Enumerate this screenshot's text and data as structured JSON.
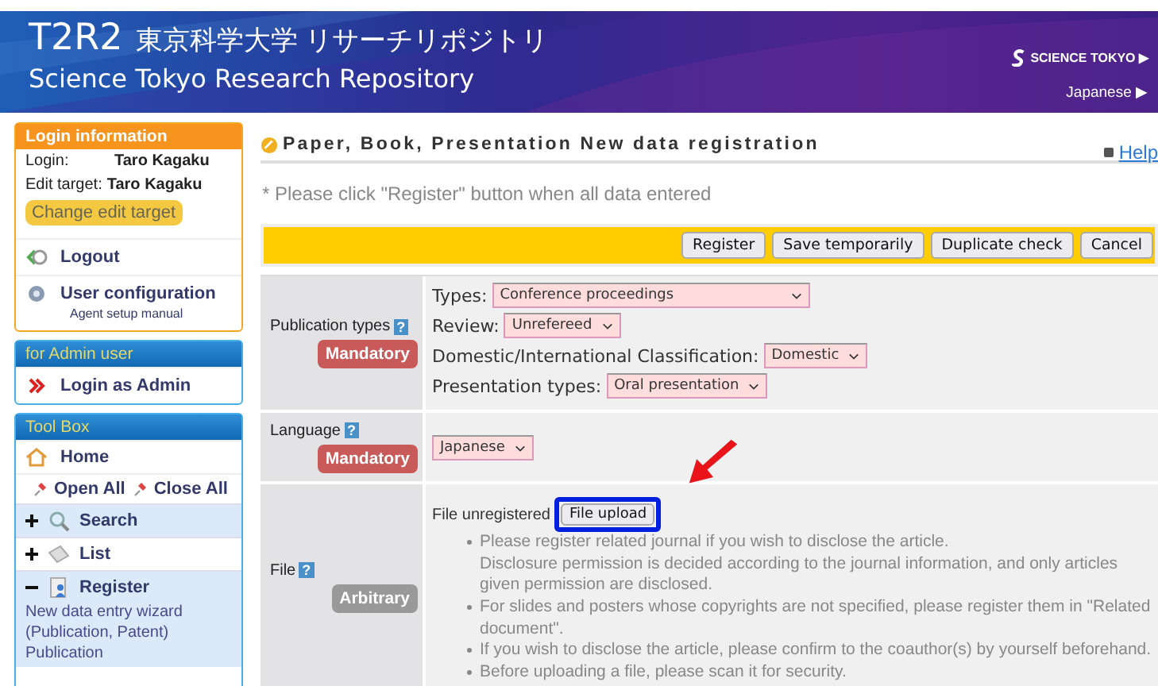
{
  "header": {
    "logo": "T2R2",
    "title_ja": "東京科学大学 リサーチリポジトリ",
    "title_en": "Science Tokyo Research Repository",
    "institute": "SCIENCE TOKYO ▶",
    "language_link": "Japanese ▶"
  },
  "login_box": {
    "title": "Login information",
    "rows": [
      {
        "label": "Login:",
        "value": "Taro Kagaku"
      },
      {
        "label": "Edit target:",
        "value": "Taro Kagaku"
      }
    ],
    "change_button": "Change edit target",
    "links": [
      {
        "kind": "logout",
        "label": "Logout"
      },
      {
        "kind": "gear",
        "label": "User configuration",
        "sub_link": "Agent setup manual"
      }
    ]
  },
  "admin_box": {
    "title": "for Admin user",
    "link": "Login as Admin"
  },
  "toolbox": {
    "title": "Tool Box",
    "home": "Home",
    "open_all": "Open All",
    "close_all": "Close All",
    "items": [
      {
        "kind": "search",
        "label": "Search",
        "expanded": false
      },
      {
        "kind": "list",
        "label": "List",
        "expanded": false
      },
      {
        "kind": "register",
        "label": "Register",
        "expanded": true,
        "children": [
          {
            "label": "New data entry wizard (Publication, Patent)"
          },
          {
            "label": "Publication"
          }
        ]
      }
    ]
  },
  "page": {
    "title": "Paper, Book, Presentation New data registration",
    "help_link": "Help",
    "note": "* Please click \"Register\" button when all data entered",
    "buttons": [
      "Register",
      "Save temporarily",
      "Duplicate check",
      "Cancel"
    ]
  },
  "form": [
    {
      "kind": "selects",
      "label": "Publication types",
      "help_mark": "?",
      "requirement": "Mandatory",
      "mandatory": true,
      "fields": [
        {
          "label": "Types:",
          "value": "Conference proceedings",
          "wide": true
        },
        {
          "label": "Review:",
          "value": "Unrefereed"
        },
        {
          "label": "Domestic/International Classification:",
          "value": "Domestic"
        },
        {
          "label": "Presentation types:",
          "value": "Oral presentation"
        }
      ]
    },
    {
      "kind": "select",
      "label": "Language",
      "help_mark": "?",
      "requirement": "Mandatory",
      "mandatory": true,
      "value": "Japanese"
    },
    {
      "kind": "file",
      "label": "File",
      "help_mark": "?",
      "requirement": "Arbitrary",
      "mandatory": false,
      "status": "File unregistered",
      "upload_button": "File upload",
      "highlighted": true,
      "notes": [
        {
          "text": "Please register related journal if you wish to disclose the article.",
          "continuation": "Disclosure permission is decided according to the journal information, and only articles given permission are disclosed."
        },
        {
          "text": "For slides and posters whose copyrights are not specified, please register them in \"Related document\"."
        },
        {
          "text": "If you wish to disclose the article, please confirm to the coauthor(s) by yourself beforehand."
        },
        {
          "text": "Before uploading a file, please scan it for security."
        }
      ]
    }
  ]
}
